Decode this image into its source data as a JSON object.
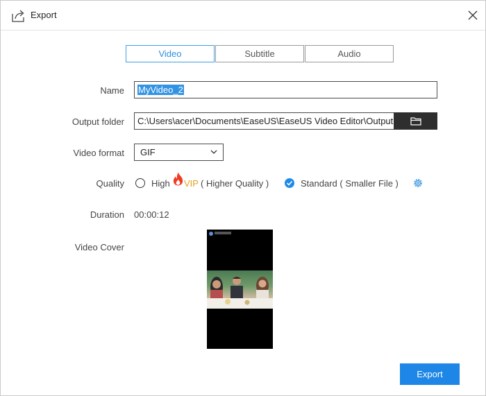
{
  "window": {
    "title": "Export"
  },
  "tabs": [
    {
      "label": "Video",
      "active": true
    },
    {
      "label": "Subtitle",
      "active": false
    },
    {
      "label": "Audio",
      "active": false
    }
  ],
  "form": {
    "name_label": "Name",
    "name_value": "MyVideo_2",
    "folder_label": "Output folder",
    "folder_value": "C:\\Users\\acer\\Documents\\EaseUS\\EaseUS Video Editor\\Output",
    "format_label": "Video format",
    "format_value": "GIF",
    "quality_label": "Quality",
    "quality_high": "High",
    "quality_vip": "VIP",
    "quality_high_note": "( Higher Quality )",
    "quality_standard": "Standard ( Smaller File )",
    "quality_selected": "Standard",
    "duration_label": "Duration",
    "duration_value": "00:00:12",
    "cover_label": "Video Cover"
  },
  "buttons": {
    "export": "Export"
  },
  "icons": {
    "title": "export-icon",
    "close": "close-icon",
    "folder": "folder-icon",
    "dropdown": "chevron-down-icon",
    "flame": "flame-icon",
    "settings": "gear-icon"
  },
  "colors": {
    "accent": "#1d86e6",
    "tab_active": "#3c9ee8",
    "vip": "#e0a21a",
    "folder_button": "#2e2e2e"
  }
}
